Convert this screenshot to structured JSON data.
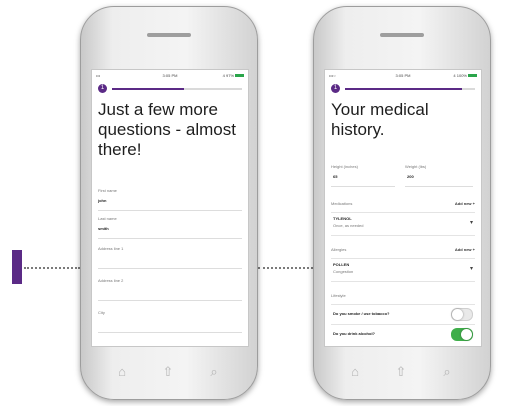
{
  "accent_color": "#5b2a86",
  "toggle_on_color": "#3fae4a",
  "left_screen": {
    "status": {
      "signal": "•••",
      "time": "3:05 PM",
      "battery": "4 97%"
    },
    "progress_step": "1",
    "progress_fraction": 0.55,
    "title": "Just a few more questions - almost there!",
    "fields": [
      {
        "label": "First name",
        "value": "john"
      },
      {
        "label": "Last name",
        "value": "smith"
      },
      {
        "label": "Address line 1",
        "value": ""
      },
      {
        "label": "Address line 2",
        "value": ""
      },
      {
        "label": "City",
        "value": ""
      }
    ]
  },
  "right_screen": {
    "status": {
      "signal": "•••○",
      "time": "3:05 PM",
      "battery": "4 100%"
    },
    "progress_step": "1",
    "progress_fraction": 0.9,
    "title": "Your medical history.",
    "height": {
      "label": "Height (inches)",
      "value": "65"
    },
    "weight": {
      "label": "Weight (lbs)",
      "value": "200"
    },
    "medications": {
      "label": "Medications",
      "add_label": "Add new +",
      "items": [
        {
          "name": "TYLENOL",
          "sub": "Once, as needed"
        }
      ]
    },
    "allergies": {
      "label": "Allergies",
      "add_label": "Add new +",
      "items": [
        {
          "name": "POLLEN",
          "sub": "Congestion"
        }
      ]
    },
    "lifestyle": {
      "label": "Lifestyle",
      "questions": [
        {
          "text": "Do you smoke / use tobacco?",
          "on": false
        },
        {
          "text": "Do you drink alcohol?",
          "on": true
        }
      ]
    }
  },
  "nav_icons": [
    "home-icon",
    "upload-icon",
    "search-icon"
  ]
}
